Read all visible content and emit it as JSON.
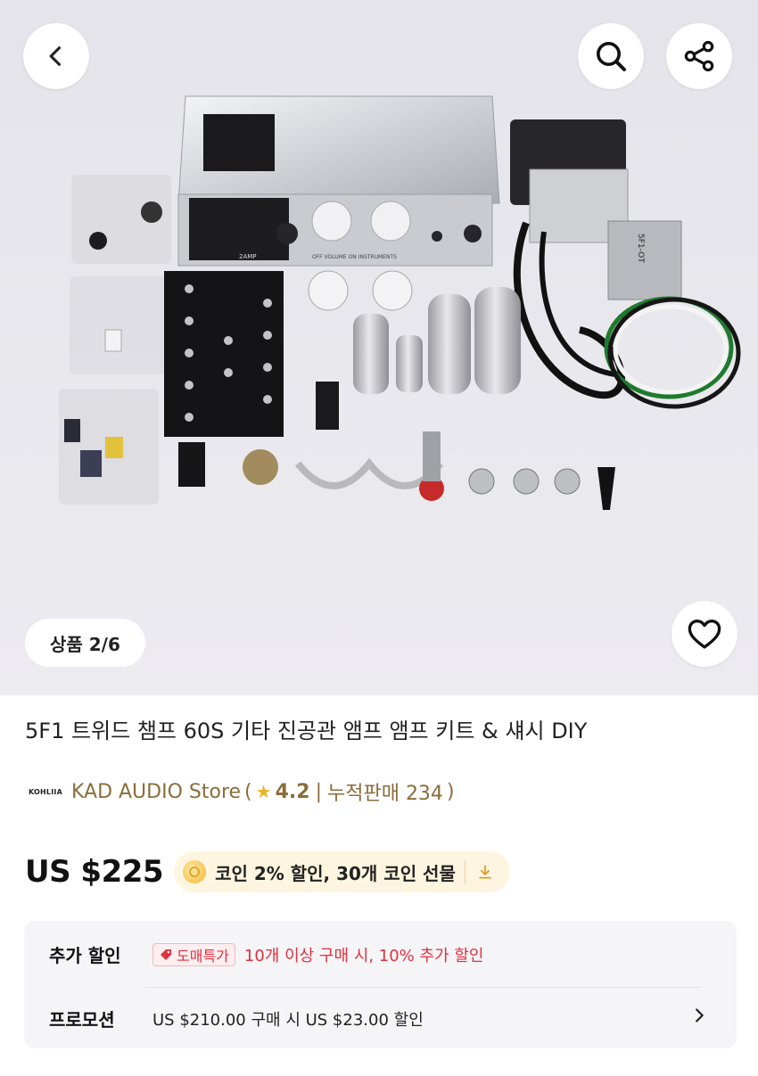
{
  "gallery": {
    "counter": "상품 2/6",
    "photo_labels": {
      "chassis": "2AMP",
      "panel": "OFF  VOLUME  ON   INSTRUMENTS",
      "output_transformer": "5F1-OT"
    }
  },
  "header": {
    "back_icon": "chevron-left-icon",
    "search_icon": "search-icon",
    "share_icon": "share-icon"
  },
  "product": {
    "title": "5F1 트위드 챔프 60S 기타 진공관 앰프 앰프 키트 & 섀시 DIY",
    "store": {
      "logo_text": "KOHLIIA",
      "name": "KAD AUDIO Store",
      "open_paren": "(",
      "rating": "4.2",
      "separator": "|",
      "sold_text": "누적판매 234",
      "close_paren": ")"
    },
    "price": "US $225",
    "coin_offer": "코인 2% 할인,  30개 코인 선물"
  },
  "discounts": {
    "extra_label": "추가 할인",
    "deal_badge": "도매특가",
    "extra_text": "10개 이상 구매 시, 10% 추가 할인",
    "promo_label": "프로모션",
    "promo_text": "US $210.00 구매 시 US $23.00 할인"
  },
  "colors": {
    "accent_red": "#e0303f",
    "store_brown": "#8a6d3b",
    "coin_bg": "#fdf5df",
    "star": "#e8b22a"
  }
}
